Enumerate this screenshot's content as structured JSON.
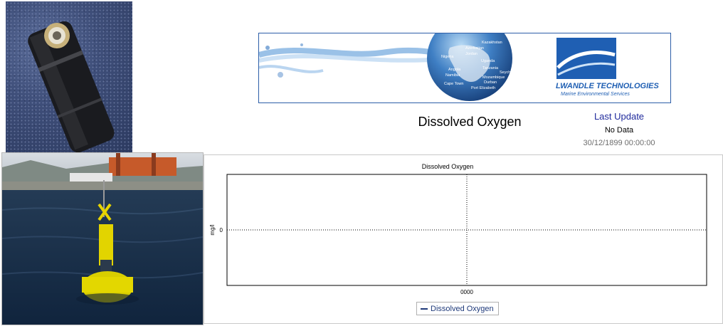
{
  "header": {
    "title": "Dissolved Oxygen",
    "last_update_label": "Last Update",
    "last_update_value": "No Data",
    "last_update_time": "30/12/1899 00:00:00"
  },
  "banner": {
    "brand_name": "LWANDLE TECHNOLOGIES",
    "brand_tagline": "Marine Environmental Services",
    "globe_labels": [
      "Kazakhstan",
      "Azerbaijan",
      "Jordan",
      "Nigeria",
      "Uganda",
      "Tanzania",
      "Seychelles",
      "Angola",
      "Namibia",
      "Mozambique",
      "Durban",
      "Cape Town",
      "Port Elizabeth"
    ],
    "colors": {
      "border": "#2d5ea8",
      "brand_blue": "#1f5fb3",
      "globe": "#3f7fc4"
    }
  },
  "images": {
    "sensor": "dissolved-oxygen-sensor-photo",
    "buoy": "yellow-monitoring-buoy-photo"
  },
  "chart_data": {
    "type": "line",
    "title": "Dissolved Oxygen",
    "ylabel": "mg/l",
    "xlabel": "",
    "y_ticks": [
      "0"
    ],
    "x_ticks": [
      "0000"
    ],
    "series": [
      {
        "name": "Dissolved Oxygen",
        "values": [],
        "color": "#1f3a7a"
      }
    ],
    "grid": true,
    "legend_position": "bottom"
  }
}
